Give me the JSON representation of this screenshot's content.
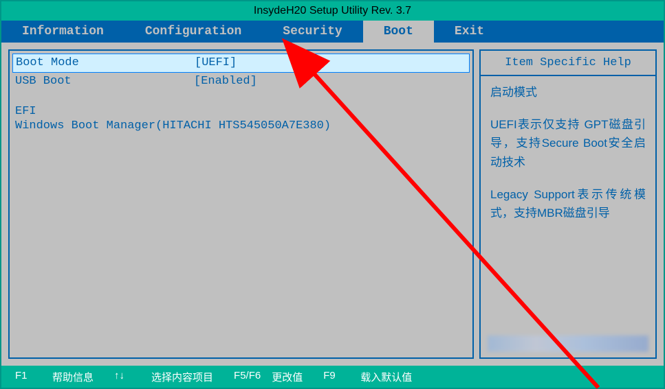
{
  "title": "InsydeH20 Setup Utility Rev. 3.7",
  "menu": {
    "items": [
      {
        "label": "Information",
        "active": false
      },
      {
        "label": "Configuration",
        "active": false
      },
      {
        "label": "Security",
        "active": false
      },
      {
        "label": "Boot",
        "active": true
      },
      {
        "label": "Exit",
        "active": false
      }
    ]
  },
  "main": {
    "rows": [
      {
        "label": "Boot Mode",
        "value": "[UEFI]",
        "selected": true
      },
      {
        "label": "USB Boot",
        "value": "[Enabled]",
        "selected": false
      }
    ],
    "section_label": "EFI",
    "boot_entry": "Windows Boot Manager(HITACHI HTS545050A7E380)"
  },
  "help": {
    "header": "Item Specific Help",
    "paragraphs": [
      "启动模式",
      "UEFI表示仅支持  GPT磁盘引导，支持Secure Boot安全启动技术",
      "Legacy  Support表示传统模式，支持MBR磁盘引导"
    ]
  },
  "footer": {
    "items": [
      {
        "key": "F1",
        "label": "帮助信息"
      },
      {
        "key": "↑↓",
        "label": "选择内容项目"
      },
      {
        "key": "F5/F6",
        "label": "更改值"
      },
      {
        "key": "F9",
        "label": "载入默认值"
      }
    ]
  }
}
